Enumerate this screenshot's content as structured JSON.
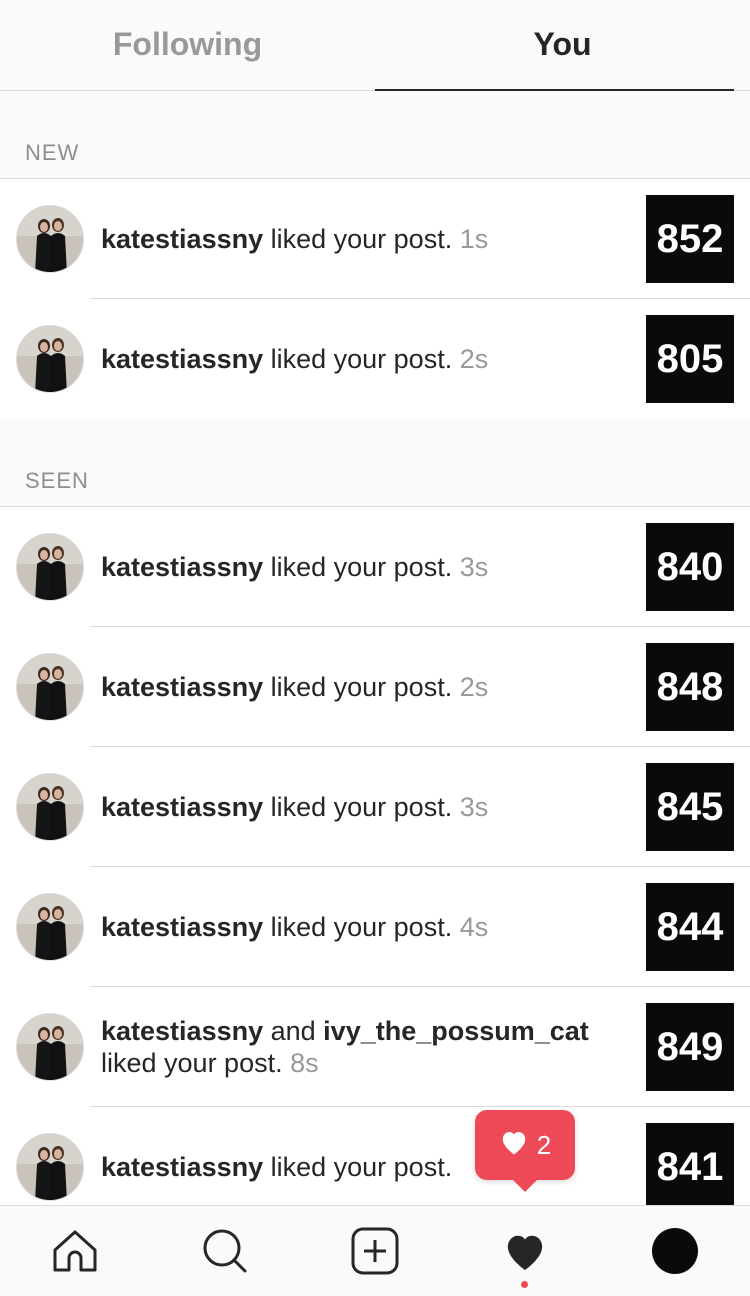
{
  "tabs": [
    {
      "label": "Following",
      "active": false
    },
    {
      "label": "You",
      "active": true
    }
  ],
  "sections": {
    "new": {
      "label": "NEW",
      "items": [
        {
          "user": "katestiassny",
          "action": " liked your post. ",
          "time": "1s",
          "thumb": "852"
        },
        {
          "user": "katestiassny",
          "action": " liked your post. ",
          "time": "2s",
          "thumb": "805"
        }
      ]
    },
    "seen": {
      "label": "SEEN",
      "items": [
        {
          "user": "katestiassny",
          "action": " liked your post. ",
          "time": "3s",
          "thumb": "840"
        },
        {
          "user": "katestiassny",
          "action": " liked your post. ",
          "time": "2s",
          "thumb": "848"
        },
        {
          "user": "katestiassny",
          "action": " liked your post. ",
          "time": "3s",
          "thumb": "845"
        },
        {
          "user": "katestiassny",
          "action": " liked your post. ",
          "time": "4s",
          "thumb": "844"
        },
        {
          "user": "katestiassny",
          "and": " and ",
          "user2": "ivy_the_possum_cat",
          "action": " liked your post. ",
          "time": "8s",
          "thumb": "849"
        },
        {
          "user": "katestiassny",
          "action": " liked your post.",
          "time": "",
          "thumb": "841"
        }
      ]
    }
  },
  "notification_bubble": {
    "count": "2",
    "icon": "heart-icon"
  },
  "bottom_nav": [
    "home-icon",
    "search-icon",
    "add-post-icon",
    "activity-heart-icon",
    "profile-avatar-icon"
  ],
  "colors": {
    "accent": "#ed4956",
    "text": "#262626",
    "muted": "#999999",
    "divider": "#dbdbdb",
    "thumb_bg": "#0a0a0a"
  }
}
